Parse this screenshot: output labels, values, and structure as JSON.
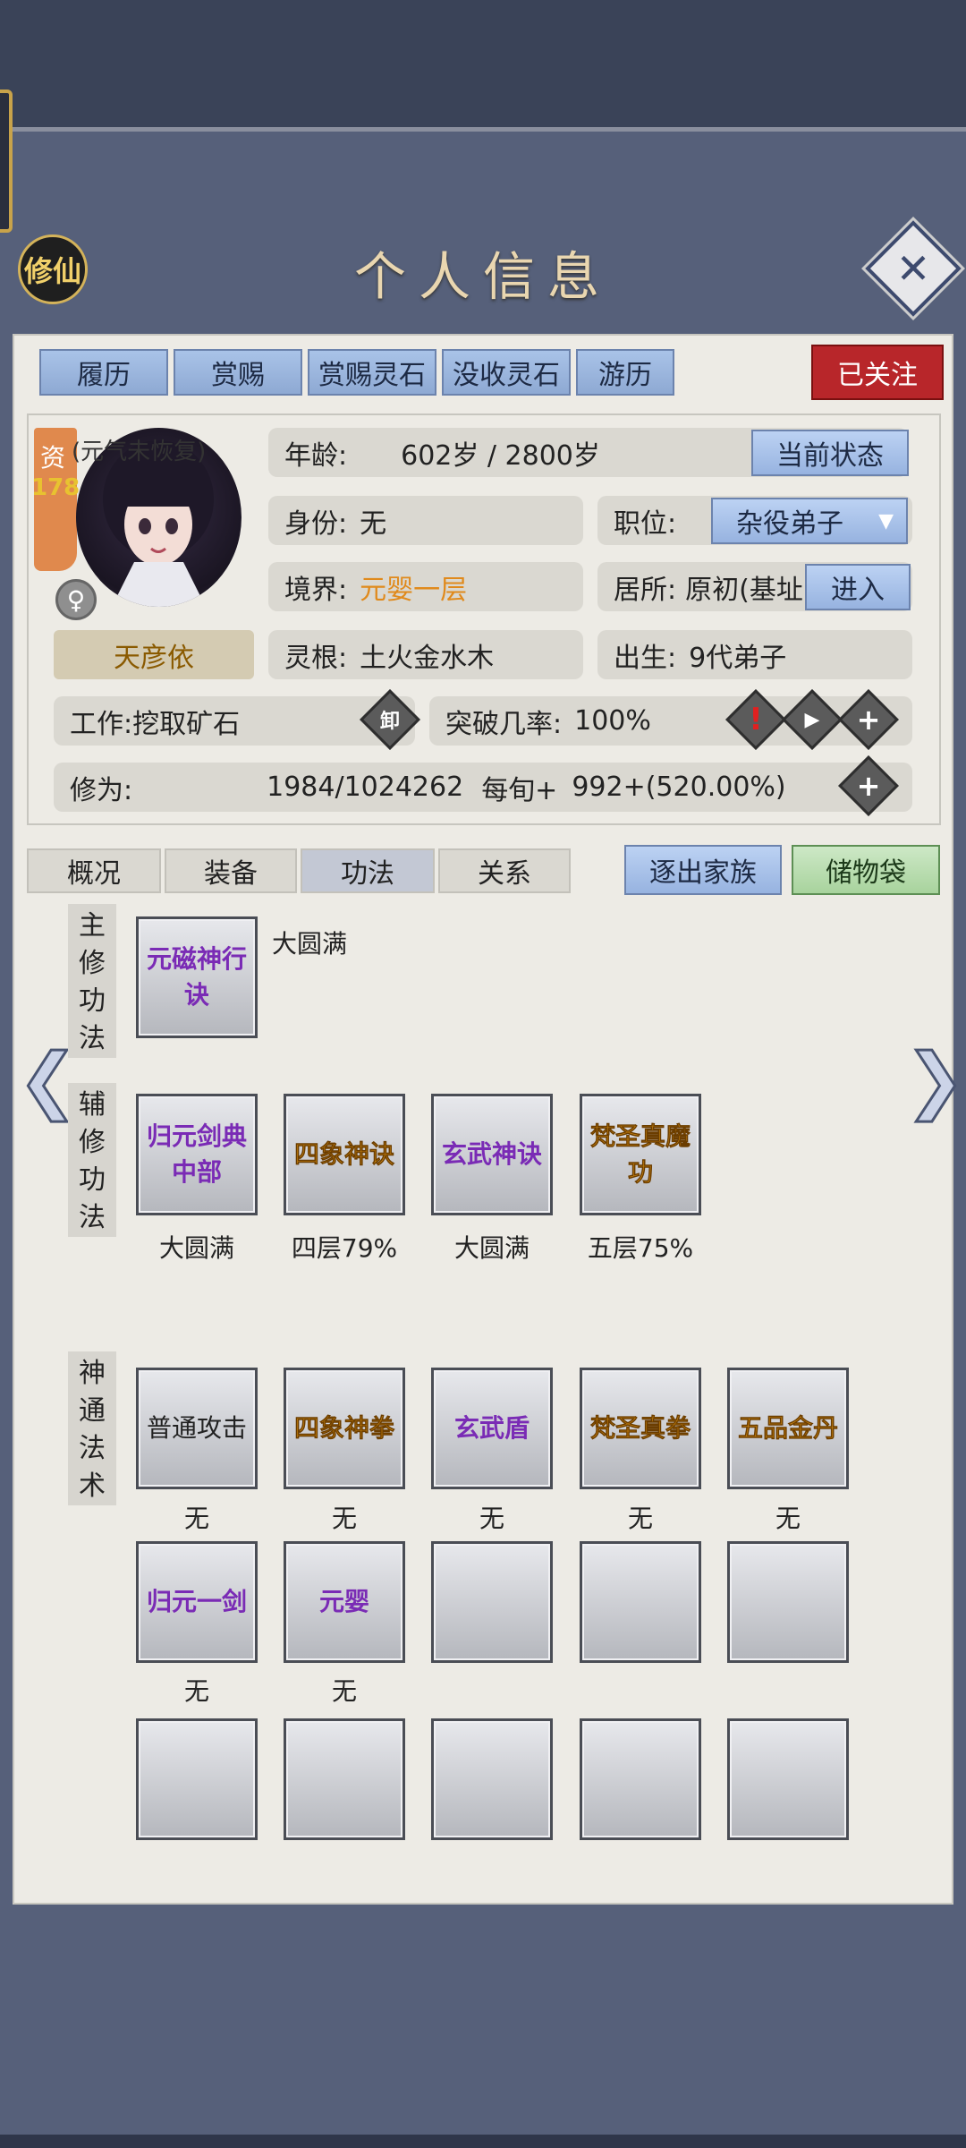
{
  "header": {
    "title": "个人信息",
    "seal_label": "修仙"
  },
  "top_tabs": [
    "履历",
    "赏赐",
    "赏赐灵石",
    "没收灵石",
    "游历"
  ],
  "followed_label": "已关注",
  "profile": {
    "aptitude_char": "资",
    "aptitude_value": "178",
    "status_note": "(元气未恢复)",
    "name": "天彦依",
    "gender_icon": "♀",
    "age_label": "年龄:",
    "age_value": "602岁 / 2800岁",
    "current_state_btn": "当前状态",
    "identity_label": "身份:",
    "identity_value": "无",
    "position_label": "职位:",
    "position_value": "杂役弟子",
    "realm_label": "境界:",
    "realm_value": "元婴一层",
    "residence_label": "居所:",
    "residence_value": "原初(基址",
    "enter_btn": "进入",
    "root_label": "灵根:",
    "root_value": "土火金水木",
    "birth_label": "出生:",
    "birth_value": "9代弟子",
    "work_label": "工作:",
    "work_value": "挖取矿石",
    "unload_icon": "卸",
    "breakthrough_label": "突破几率:",
    "breakthrough_value": "100%",
    "cultivation_label": "修为:",
    "cultivation_value": "1984/1024262",
    "per_period_label": "每旬+",
    "per_period_value": "992+(520.00%)"
  },
  "sub_tabs": [
    "概况",
    "装备",
    "功法",
    "关系"
  ],
  "expel_btn": "逐出家族",
  "storage_btn": "储物袋",
  "sections": {
    "main": "主修功法",
    "aux": "辅修功法",
    "skill": "神通法术"
  },
  "main_skill": {
    "name": "元磁神行诀",
    "level": "大圆满"
  },
  "aux_skills": [
    {
      "name": "归元剑典中部",
      "level": "大圆满",
      "color": "purple"
    },
    {
      "name": "四象神诀",
      "level": "四层79%",
      "color": "gold"
    },
    {
      "name": "玄武神诀",
      "level": "大圆满",
      "color": "purple"
    },
    {
      "name": "梵圣真魔功",
      "level": "五层75%",
      "color": "gold"
    }
  ],
  "arts_row1": [
    {
      "name": "普通攻击",
      "level": "无",
      "color": "black"
    },
    {
      "name": "四象神拳",
      "level": "无",
      "color": "gold"
    },
    {
      "name": "玄武盾",
      "level": "无",
      "color": "purple"
    },
    {
      "name": "梵圣真拳",
      "level": "无",
      "color": "gold"
    },
    {
      "name": "五品金丹",
      "level": "无",
      "color": "gold"
    }
  ],
  "arts_row2": [
    {
      "name": "归元一剑",
      "level": "无",
      "color": "purple"
    },
    {
      "name": "元婴",
      "level": "无",
      "color": "purple"
    }
  ],
  "colors": {
    "accent_blue": "#97b3e0",
    "followed_red": "#b8262a",
    "realm_orange": "#e08a1c",
    "skill_purple": "#7a2bb5",
    "skill_gold": "#d18a10"
  }
}
